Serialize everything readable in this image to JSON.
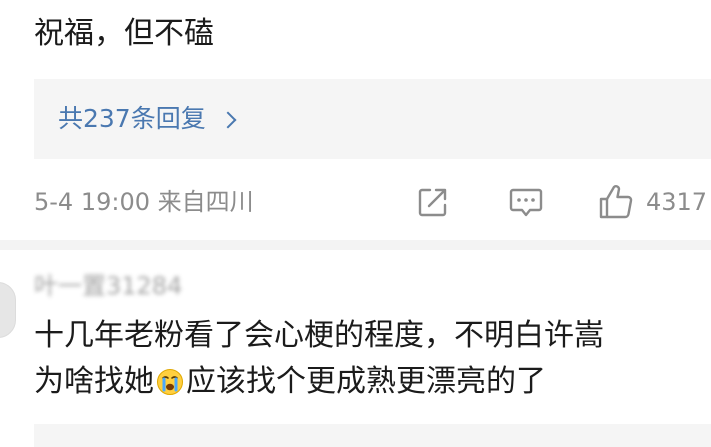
{
  "comment_top": {
    "text": "祝福，但不磕",
    "reply_summary": "共237条回复",
    "time_location": "5-4 19:00 来自四川",
    "like_count": "4317"
  },
  "comment_next": {
    "username": "叶一置31284",
    "text_line1": "十几年老粉看了会心梗的程度，不明白许嵩",
    "text_line2_part1": "为啥找她",
    "emoji": "crying-face",
    "text_line2_part2": "应该找个更成熟更漂亮的了"
  },
  "icons": {
    "forward": "forward-icon",
    "comment": "comment-icon",
    "like": "thumbs-up-icon",
    "chevron": "chevron-right-icon"
  },
  "colors": {
    "link_blue": "#4a78b0",
    "meta_gray": "#8c8c8c",
    "text_black": "#1b1b1b",
    "panel_gray": "#f5f5f5"
  }
}
